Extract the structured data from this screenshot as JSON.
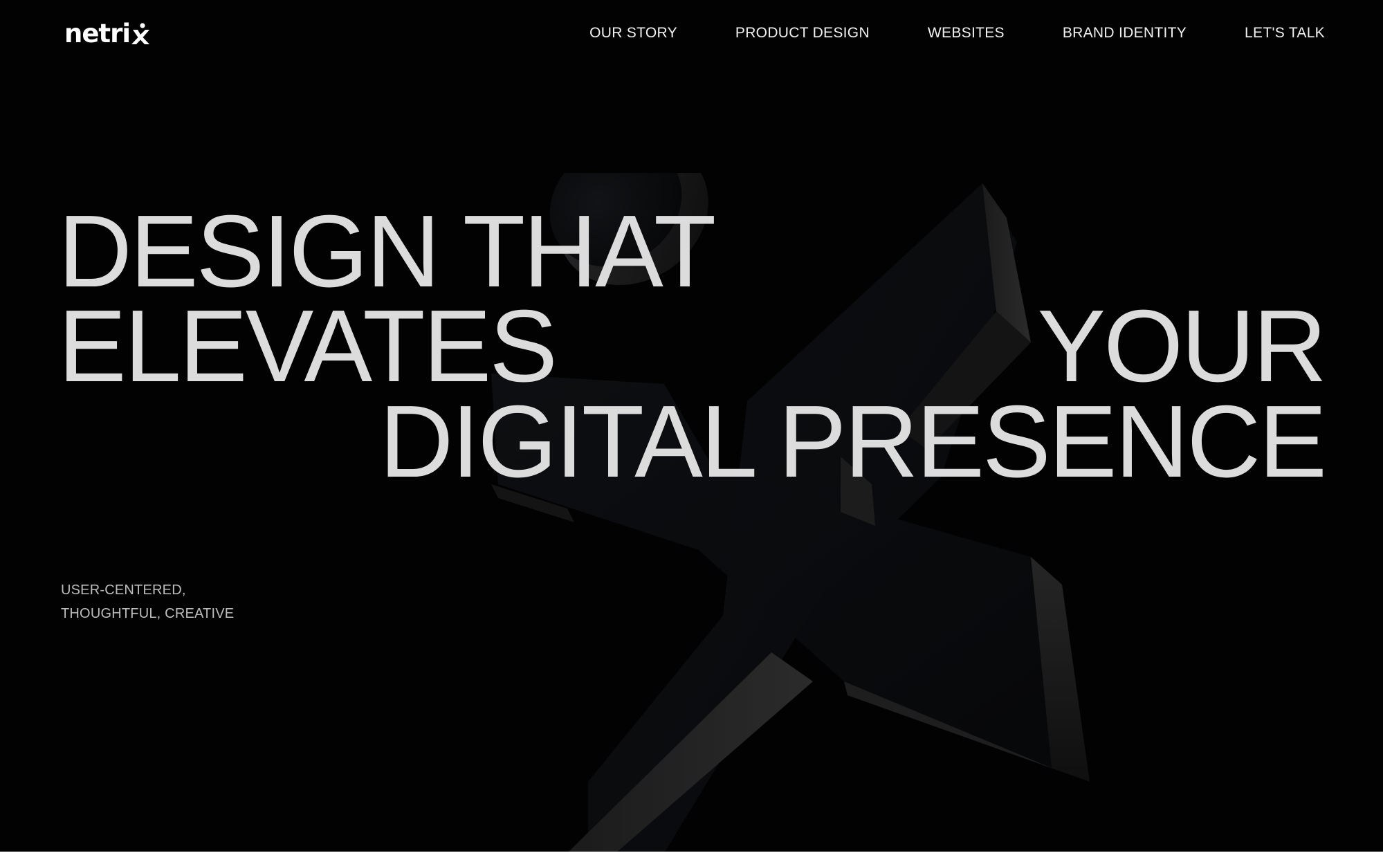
{
  "header": {
    "logo_text": "netri",
    "logo_mark": "x-mark-icon",
    "nav": [
      {
        "label": "OUR STORY"
      },
      {
        "label": "PRODUCT DESIGN"
      },
      {
        "label": "WEBSITES"
      },
      {
        "label": "BRAND IDENTITY"
      },
      {
        "label": "LET'S TALK"
      }
    ]
  },
  "hero": {
    "headline_line_1": "DESIGN THAT",
    "headline_line_2_left": "ELEVATES",
    "headline_line_2_right": "YOUR",
    "headline_line_3": "DIGITAL PRESENCE",
    "tagline_line_1": "USER-CENTERED,",
    "tagline_line_2": "THOUGHTFUL, CREATIVE",
    "graphic": "3d-x-figure-icon"
  },
  "colors": {
    "background": "#020202",
    "headline": "#dcdcdc",
    "nav_text": "#f2f2f2",
    "tagline": "#bdbdbd"
  }
}
